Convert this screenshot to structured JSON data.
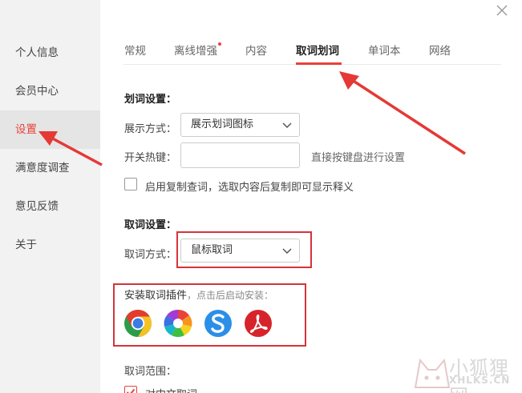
{
  "sidebar": {
    "items": [
      {
        "label": "个人信息"
      },
      {
        "label": "会员中心"
      },
      {
        "label": "设置",
        "active": true
      },
      {
        "label": "满意度调查"
      },
      {
        "label": "意见反馈"
      },
      {
        "label": "关于"
      }
    ]
  },
  "tabs": [
    {
      "label": "常规"
    },
    {
      "label": "离线增强",
      "badge": "new-dot"
    },
    {
      "label": "内容"
    },
    {
      "label": "取词划词",
      "active": true
    },
    {
      "label": "单词本"
    },
    {
      "label": "网络"
    }
  ],
  "huaci": {
    "title": "划词设置：",
    "display_label": "展示方式：",
    "display_value": "展示划词图标",
    "hotkey_label": "开关热键：",
    "hotkey_value": "",
    "hotkey_hint": "直接按键盘进行设置",
    "copy_lookup_label": "启用复制查词，选取内容后复制即可显示释义",
    "copy_lookup_checked": false
  },
  "quci": {
    "title": "取词设置：",
    "mode_label": "取词方式：",
    "mode_value": "鼠标取词",
    "plugin_title": "安装取词插件",
    "plugin_subtitle": "，点击后启动安装：",
    "plugins": [
      "chrome-icon",
      "360-browser-icon",
      "sogou-browser-icon",
      "adobe-acrobat-icon"
    ],
    "range_label": "取词范围：",
    "range_option_label": "对中文取词",
    "range_option_checked": true
  },
  "watermark": {
    "title": "小狐狸网",
    "subtitle": "XHLKS.CN"
  },
  "colors": {
    "accent": "#e8423b",
    "highlight_box": "#d6333a",
    "sidebar_bg": "#f2f2f2",
    "sidebar_active_bg": "#e5e5e5"
  }
}
